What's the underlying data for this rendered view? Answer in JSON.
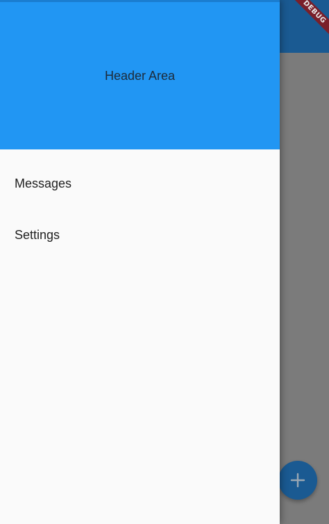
{
  "drawer": {
    "header_title": "Header Area",
    "items": [
      {
        "label": "Messages"
      },
      {
        "label": "Settings"
      }
    ]
  },
  "debug_banner": {
    "label": "DEBUG"
  },
  "fab": {
    "icon": "add-icon"
  },
  "colors": {
    "header": "#2196f3",
    "drawer_background": "#fafafa",
    "app_bar_dimmed": "#1a5a92",
    "scrim_body": "#7b7b7b",
    "debug_ribbon": "#7a1f2a"
  }
}
